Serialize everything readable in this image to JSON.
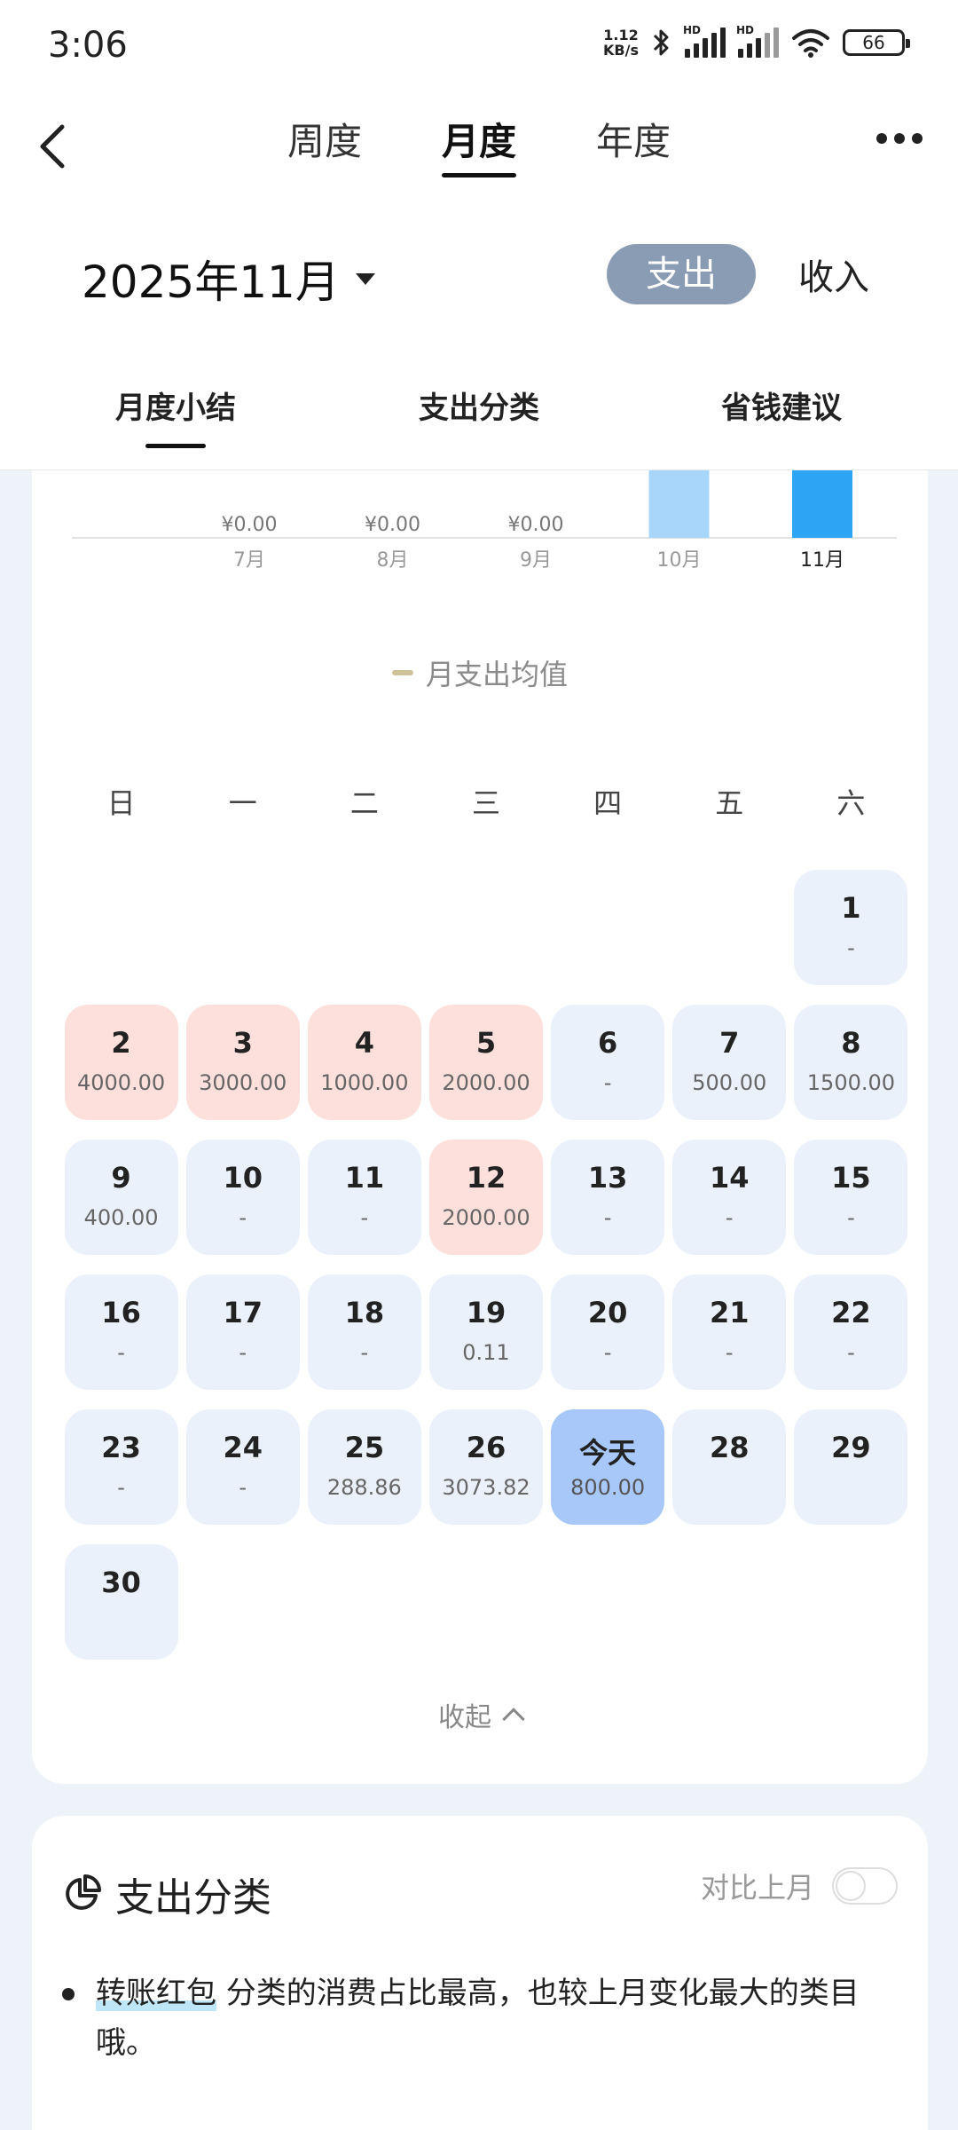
{
  "status_bar": {
    "time": "3:06",
    "net_speed_value": "1.12",
    "net_speed_unit": "KB/s",
    "signal_1_label": "HD",
    "signal_2_label": "HD",
    "battery": "66"
  },
  "nav": {
    "tabs": [
      "周度",
      "月度",
      "年度"
    ],
    "active_tab": "月度"
  },
  "month": {
    "title": "2025年11月",
    "type_options": [
      "支出",
      "收入"
    ],
    "active_type": "支出"
  },
  "section_tabs": {
    "items": [
      "月度小结",
      "支出分类",
      "省钱建议"
    ],
    "active": "月度小结"
  },
  "chart_data": {
    "type": "bar",
    "categories": [
      "7月",
      "8月",
      "9月",
      "10月",
      "11月"
    ],
    "value_labels": [
      "¥0.00",
      "¥0.00",
      "¥0.00",
      "",
      ""
    ],
    "bar_colors": [
      "#a8d6fb",
      "#a8d6fb",
      "#a8d6fb",
      "#a8d6fb",
      "#2ea4f5"
    ],
    "title": "",
    "xlabel": "",
    "ylabel": "",
    "legend": [
      "月支出均值"
    ],
    "legend_color": "#cfc29b"
  },
  "calendar": {
    "weekdays": [
      "日",
      "一",
      "二",
      "三",
      "四",
      "五",
      "六"
    ],
    "weeks": [
      [
        null,
        null,
        null,
        null,
        null,
        null,
        {
          "day": "1",
          "amount": "-",
          "state": "normal"
        }
      ],
      [
        {
          "day": "2",
          "amount": "4000.00",
          "state": "high"
        },
        {
          "day": "3",
          "amount": "3000.00",
          "state": "high"
        },
        {
          "day": "4",
          "amount": "1000.00",
          "state": "high"
        },
        {
          "day": "5",
          "amount": "2000.00",
          "state": "high"
        },
        {
          "day": "6",
          "amount": "-",
          "state": "normal"
        },
        {
          "day": "7",
          "amount": "500.00",
          "state": "normal"
        },
        {
          "day": "8",
          "amount": "1500.00",
          "state": "normal"
        }
      ],
      [
        {
          "day": "9",
          "amount": "400.00",
          "state": "normal"
        },
        {
          "day": "10",
          "amount": "-",
          "state": "normal"
        },
        {
          "day": "11",
          "amount": "-",
          "state": "normal"
        },
        {
          "day": "12",
          "amount": "2000.00",
          "state": "high"
        },
        {
          "day": "13",
          "amount": "-",
          "state": "normal"
        },
        {
          "day": "14",
          "amount": "-",
          "state": "normal"
        },
        {
          "day": "15",
          "amount": "-",
          "state": "normal"
        }
      ],
      [
        {
          "day": "16",
          "amount": "-",
          "state": "normal"
        },
        {
          "day": "17",
          "amount": "-",
          "state": "normal"
        },
        {
          "day": "18",
          "amount": "-",
          "state": "normal"
        },
        {
          "day": "19",
          "amount": "0.11",
          "state": "normal"
        },
        {
          "day": "20",
          "amount": "-",
          "state": "normal"
        },
        {
          "day": "21",
          "amount": "-",
          "state": "normal"
        },
        {
          "day": "22",
          "amount": "-",
          "state": "normal"
        }
      ],
      [
        {
          "day": "23",
          "amount": "-",
          "state": "normal"
        },
        {
          "day": "24",
          "amount": "-",
          "state": "normal"
        },
        {
          "day": "25",
          "amount": "288.86",
          "state": "normal"
        },
        {
          "day": "26",
          "amount": "3073.82",
          "state": "normal"
        },
        {
          "day": "今天",
          "amount": "800.00",
          "state": "today"
        },
        {
          "day": "28",
          "amount": "",
          "state": "normal"
        },
        {
          "day": "29",
          "amount": "",
          "state": "normal"
        }
      ],
      [
        {
          "day": "30",
          "amount": "",
          "state": "normal"
        },
        null,
        null,
        null,
        null,
        null,
        null
      ]
    ],
    "collapse_label": "收起"
  },
  "category_card": {
    "title": "支出分类",
    "compare_label": "对比上月",
    "compare_on": false,
    "insight_highlight": "转账红包",
    "insight_rest": " 分类的消费占比最高，也较上月变化最大的类目哦。"
  }
}
